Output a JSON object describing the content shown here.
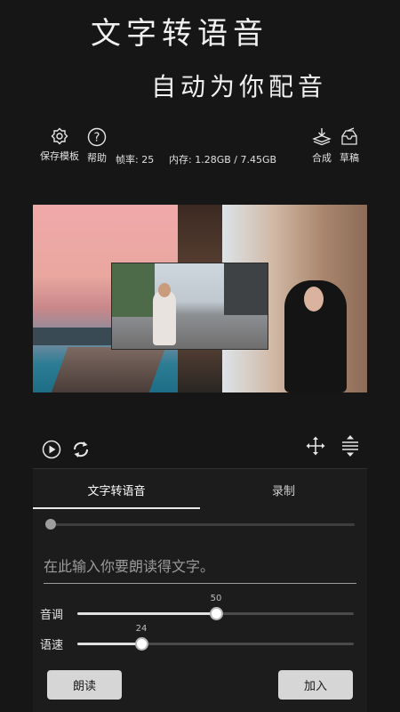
{
  "header": {
    "title": "文字转语音",
    "subtitle": "自动为你配音"
  },
  "toolbar": {
    "save_template_label": "保存模板",
    "help_label": "帮助",
    "frame_rate": "帧率: 25",
    "memory": "内存: 1.28GB / 7.45GB",
    "compose_label": "合成",
    "draft_label": "草稿"
  },
  "icons": {
    "save_template": "gear-icon",
    "help": "help-icon",
    "compose": "layers-download-icon",
    "draft": "draft-icon",
    "play": "play-icon",
    "reset": "refresh-icon",
    "move": "move-arrows-icon",
    "align": "vertical-align-icon"
  },
  "tabs": [
    {
      "label": "文字转语音",
      "active": true
    },
    {
      "label": "录制",
      "active": false
    }
  ],
  "timeline": {
    "position": 0
  },
  "input": {
    "placeholder": "在此输入你要朗读得文字。",
    "value": ""
  },
  "pitch": {
    "label": "音调",
    "value": "50",
    "fraction": 0.5
  },
  "speed": {
    "label": "语速",
    "value": "24",
    "fraction": 0.23
  },
  "buttons": {
    "read": "朗读",
    "add": "加入"
  },
  "colors": {
    "background": "#161616",
    "panel": "#1c1c1c",
    "slider_track": "#4a4a4a",
    "slider_fill": "#e0e0e0",
    "button": "#d6d6d6"
  }
}
